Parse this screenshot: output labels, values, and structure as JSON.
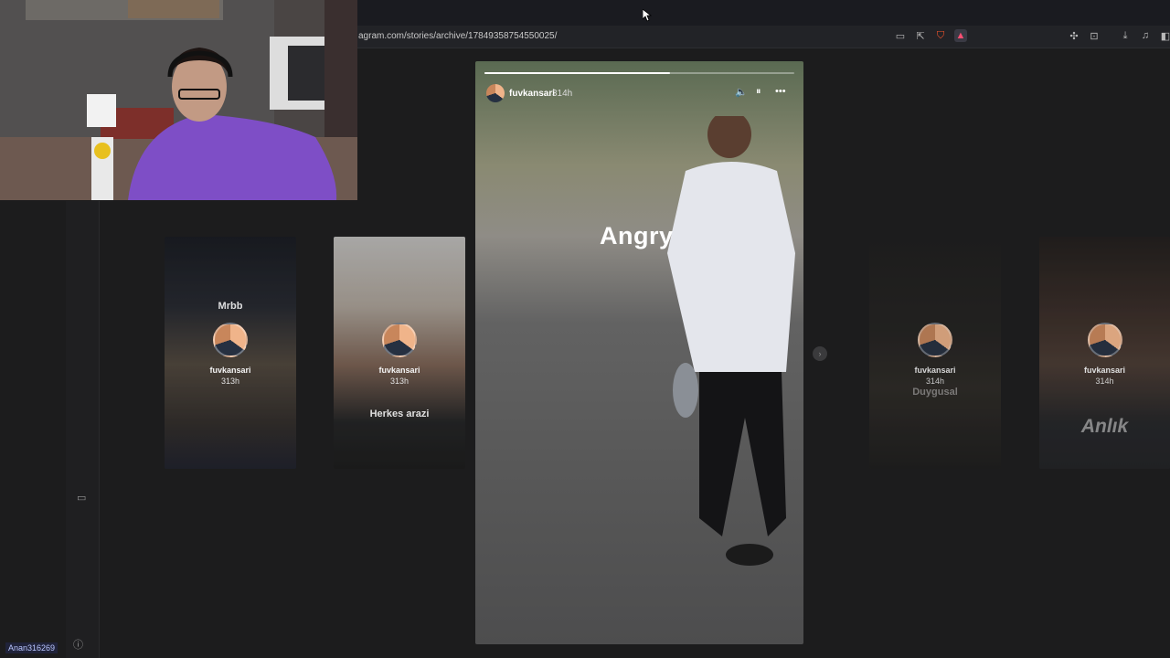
{
  "browser": {
    "url": "agram.com/stories/archive/17849358754550025/"
  },
  "main_story": {
    "username": "fuvkansari",
    "time": "314h",
    "caption": "Angry",
    "progress_percent": 60
  },
  "thumbnails": [
    {
      "caption": "Mrbb",
      "username": "fuvkansari",
      "time": "313h"
    },
    {
      "caption": "Herkes arazi",
      "username": "fuvkansari",
      "time": "313h"
    },
    {
      "caption": "Duygusal",
      "username": "fuvkansari",
      "time": "314h"
    },
    {
      "caption": "Anlık",
      "username": "fuvkansari",
      "time": "314h"
    }
  ],
  "taskbar": {
    "username": "Anan316269"
  }
}
